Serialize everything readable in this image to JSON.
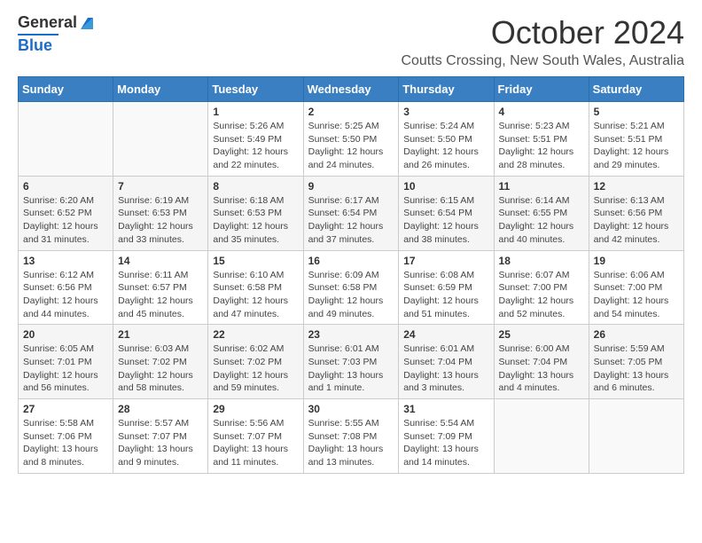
{
  "logo": {
    "line1": "General",
    "line2": "Blue"
  },
  "header": {
    "month": "October 2024",
    "location": "Coutts Crossing, New South Wales, Australia"
  },
  "weekdays": [
    "Sunday",
    "Monday",
    "Tuesday",
    "Wednesday",
    "Thursday",
    "Friday",
    "Saturday"
  ],
  "weeks": [
    [
      {
        "day": "",
        "info": ""
      },
      {
        "day": "",
        "info": ""
      },
      {
        "day": "1",
        "info": "Sunrise: 5:26 AM\nSunset: 5:49 PM\nDaylight: 12 hours and 22 minutes."
      },
      {
        "day": "2",
        "info": "Sunrise: 5:25 AM\nSunset: 5:50 PM\nDaylight: 12 hours and 24 minutes."
      },
      {
        "day": "3",
        "info": "Sunrise: 5:24 AM\nSunset: 5:50 PM\nDaylight: 12 hours and 26 minutes."
      },
      {
        "day": "4",
        "info": "Sunrise: 5:23 AM\nSunset: 5:51 PM\nDaylight: 12 hours and 28 minutes."
      },
      {
        "day": "5",
        "info": "Sunrise: 5:21 AM\nSunset: 5:51 PM\nDaylight: 12 hours and 29 minutes."
      }
    ],
    [
      {
        "day": "6",
        "info": "Sunrise: 6:20 AM\nSunset: 6:52 PM\nDaylight: 12 hours and 31 minutes."
      },
      {
        "day": "7",
        "info": "Sunrise: 6:19 AM\nSunset: 6:53 PM\nDaylight: 12 hours and 33 minutes."
      },
      {
        "day": "8",
        "info": "Sunrise: 6:18 AM\nSunset: 6:53 PM\nDaylight: 12 hours and 35 minutes."
      },
      {
        "day": "9",
        "info": "Sunrise: 6:17 AM\nSunset: 6:54 PM\nDaylight: 12 hours and 37 minutes."
      },
      {
        "day": "10",
        "info": "Sunrise: 6:15 AM\nSunset: 6:54 PM\nDaylight: 12 hours and 38 minutes."
      },
      {
        "day": "11",
        "info": "Sunrise: 6:14 AM\nSunset: 6:55 PM\nDaylight: 12 hours and 40 minutes."
      },
      {
        "day": "12",
        "info": "Sunrise: 6:13 AM\nSunset: 6:56 PM\nDaylight: 12 hours and 42 minutes."
      }
    ],
    [
      {
        "day": "13",
        "info": "Sunrise: 6:12 AM\nSunset: 6:56 PM\nDaylight: 12 hours and 44 minutes."
      },
      {
        "day": "14",
        "info": "Sunrise: 6:11 AM\nSunset: 6:57 PM\nDaylight: 12 hours and 45 minutes."
      },
      {
        "day": "15",
        "info": "Sunrise: 6:10 AM\nSunset: 6:58 PM\nDaylight: 12 hours and 47 minutes."
      },
      {
        "day": "16",
        "info": "Sunrise: 6:09 AM\nSunset: 6:58 PM\nDaylight: 12 hours and 49 minutes."
      },
      {
        "day": "17",
        "info": "Sunrise: 6:08 AM\nSunset: 6:59 PM\nDaylight: 12 hours and 51 minutes."
      },
      {
        "day": "18",
        "info": "Sunrise: 6:07 AM\nSunset: 7:00 PM\nDaylight: 12 hours and 52 minutes."
      },
      {
        "day": "19",
        "info": "Sunrise: 6:06 AM\nSunset: 7:00 PM\nDaylight: 12 hours and 54 minutes."
      }
    ],
    [
      {
        "day": "20",
        "info": "Sunrise: 6:05 AM\nSunset: 7:01 PM\nDaylight: 12 hours and 56 minutes."
      },
      {
        "day": "21",
        "info": "Sunrise: 6:03 AM\nSunset: 7:02 PM\nDaylight: 12 hours and 58 minutes."
      },
      {
        "day": "22",
        "info": "Sunrise: 6:02 AM\nSunset: 7:02 PM\nDaylight: 12 hours and 59 minutes."
      },
      {
        "day": "23",
        "info": "Sunrise: 6:01 AM\nSunset: 7:03 PM\nDaylight: 13 hours and 1 minute."
      },
      {
        "day": "24",
        "info": "Sunrise: 6:01 AM\nSunset: 7:04 PM\nDaylight: 13 hours and 3 minutes."
      },
      {
        "day": "25",
        "info": "Sunrise: 6:00 AM\nSunset: 7:04 PM\nDaylight: 13 hours and 4 minutes."
      },
      {
        "day": "26",
        "info": "Sunrise: 5:59 AM\nSunset: 7:05 PM\nDaylight: 13 hours and 6 minutes."
      }
    ],
    [
      {
        "day": "27",
        "info": "Sunrise: 5:58 AM\nSunset: 7:06 PM\nDaylight: 13 hours and 8 minutes."
      },
      {
        "day": "28",
        "info": "Sunrise: 5:57 AM\nSunset: 7:07 PM\nDaylight: 13 hours and 9 minutes."
      },
      {
        "day": "29",
        "info": "Sunrise: 5:56 AM\nSunset: 7:07 PM\nDaylight: 13 hours and 11 minutes."
      },
      {
        "day": "30",
        "info": "Sunrise: 5:55 AM\nSunset: 7:08 PM\nDaylight: 13 hours and 13 minutes."
      },
      {
        "day": "31",
        "info": "Sunrise: 5:54 AM\nSunset: 7:09 PM\nDaylight: 13 hours and 14 minutes."
      },
      {
        "day": "",
        "info": ""
      },
      {
        "day": "",
        "info": ""
      }
    ]
  ]
}
